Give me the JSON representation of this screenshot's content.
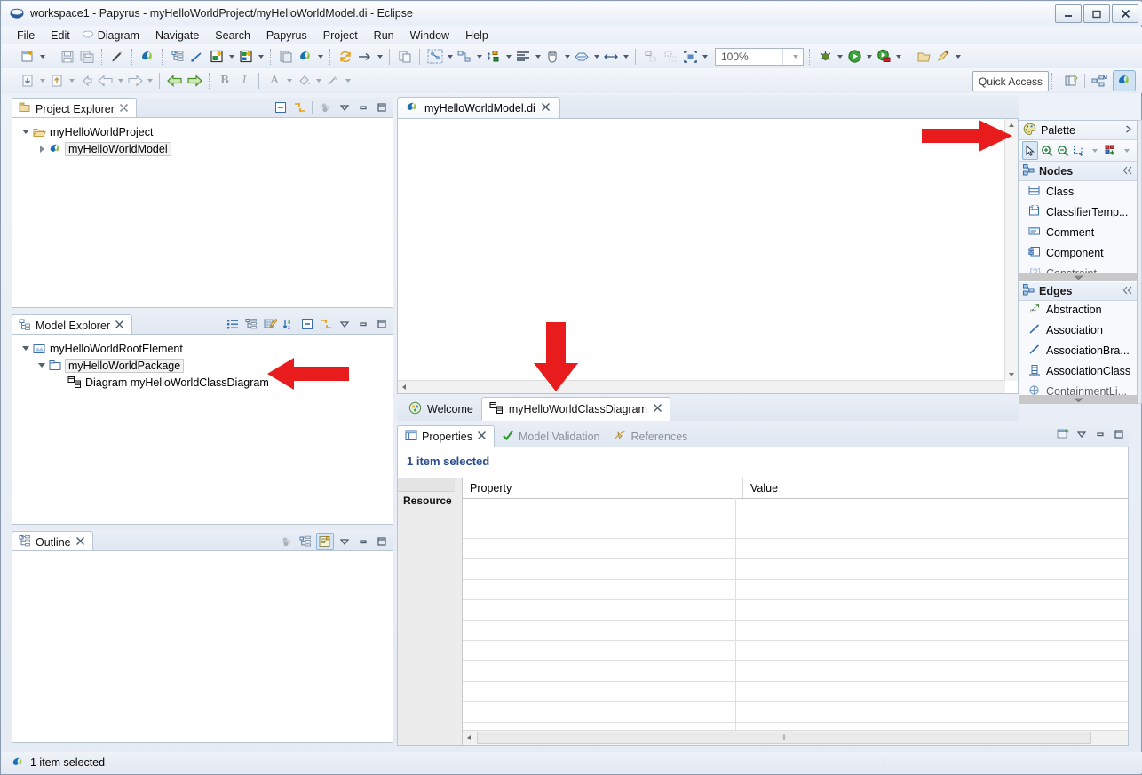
{
  "window": {
    "title": "workspace1 - Papyrus - myHelloWorldProject/myHelloWorldModel.di - Eclipse",
    "icon": "papyrus-icon",
    "minimize_label": "–",
    "maximize_label": "❐",
    "close_label": "✕"
  },
  "menubar": [
    {
      "label": "File",
      "icon": null
    },
    {
      "label": "Edit",
      "icon": null
    },
    {
      "label": "Diagram",
      "icon": "papyrus-icon"
    },
    {
      "label": "Navigate",
      "icon": null
    },
    {
      "label": "Search",
      "icon": null
    },
    {
      "label": "Papyrus",
      "icon": null
    },
    {
      "label": "Project",
      "icon": null
    },
    {
      "label": "Run",
      "icon": null
    },
    {
      "label": "Window",
      "icon": null
    },
    {
      "label": "Help",
      "icon": null
    }
  ],
  "toolbar_row1": {
    "zoom_value": "100%",
    "zoom_dropdown_icon": "chevron-down-icon",
    "items": [
      {
        "name": "new-wizard-button",
        "icon": "new-file-icon",
        "dropdown": true
      },
      {
        "sep": "dotted"
      },
      {
        "name": "save-button",
        "icon": "save-icon",
        "dropdown": false
      },
      {
        "name": "save-all-button",
        "icon": "save-all-icon",
        "dropdown": false
      },
      {
        "sep": "dotted"
      },
      {
        "name": "edit-pencil-button",
        "icon": "pencil-icon",
        "dropdown": false
      },
      {
        "sep": "dotted"
      },
      {
        "name": "papyrus-perspective-button",
        "icon": "papyrus-icon",
        "dropdown": false
      },
      {
        "sep": "dotted"
      },
      {
        "name": "outline-tree-button",
        "icon": "tree-outline-icon",
        "dropdown": false
      },
      {
        "name": "link-line-button",
        "icon": "diagonal-line-icon",
        "dropdown": false
      },
      {
        "name": "new-diagram-button",
        "icon": "new-diagram-icon",
        "dropdown": true
      },
      {
        "name": "new-model-button",
        "icon": "new-model-icon",
        "dropdown": true
      },
      {
        "sep": "dotted"
      },
      {
        "name": "copy-appearance-button",
        "icon": "copy-appearance-icon",
        "dropdown": false
      },
      {
        "name": "papyrus-menu-button",
        "icon": "papyrus-icon",
        "dropdown": true
      },
      {
        "sep": "dotted"
      },
      {
        "name": "refresh-button",
        "icon": "refresh-icon",
        "dropdown": false
      },
      {
        "name": "arrow-tool-button",
        "icon": "right-arrow-icon",
        "dropdown": true
      },
      {
        "sep": "solid"
      },
      {
        "name": "paste-style-button",
        "icon": "paste-style-icon",
        "dropdown": false
      },
      {
        "sep": "solid"
      },
      {
        "name": "select-all-button",
        "icon": "select-nodes-icon",
        "dropdown": true
      },
      {
        "name": "arrange-all-button",
        "icon": "arrange-icon",
        "dropdown": true
      },
      {
        "name": "distribute-button",
        "icon": "distribute-icon",
        "dropdown": true
      },
      {
        "name": "align-button",
        "icon": "align-left-icon",
        "dropdown": true
      },
      {
        "name": "hand-tool-button",
        "icon": "hand-icon",
        "dropdown": true
      },
      {
        "name": "routing-button",
        "icon": "routing-icon",
        "dropdown": true
      },
      {
        "name": "resize-button",
        "icon": "horizontal-resize-icon",
        "dropdown": true
      },
      {
        "sep": "solid"
      },
      {
        "name": "snap-button",
        "icon": "snap-icon",
        "dropdown": false
      },
      {
        "name": "grid-button",
        "icon": "grid-icon",
        "dropdown": false
      },
      {
        "name": "zoom-fit-button",
        "icon": "zoom-fit-icon",
        "dropdown": true
      }
    ],
    "trailing": [
      {
        "name": "debug-button",
        "icon": "debug-bug-icon",
        "dropdown": true
      },
      {
        "name": "run-button",
        "icon": "run-play-icon",
        "dropdown": true
      },
      {
        "name": "coverage-button",
        "icon": "coverage-icon",
        "dropdown": true
      },
      {
        "sep": "dotted"
      },
      {
        "name": "open-type-button",
        "icon": "open-folder-icon",
        "dropdown": false
      },
      {
        "name": "external-tools-button",
        "icon": "external-tools-icon",
        "dropdown": true
      }
    ]
  },
  "toolbar_row2": {
    "quick_access_label": "Quick Access",
    "items": [
      {
        "name": "import-button",
        "icon": "import-icon",
        "dropdown": true
      },
      {
        "name": "export-button",
        "icon": "export-icon",
        "dropdown": true
      },
      {
        "name": "back-history-button",
        "icon": "back-small-icon",
        "dropdown": false
      },
      {
        "name": "previous-annotation-button",
        "icon": "left-arrow-outline-icon",
        "dropdown": true
      },
      {
        "name": "next-annotation-button",
        "icon": "right-arrow-outline-icon",
        "dropdown": true
      },
      {
        "sep": "solid"
      },
      {
        "name": "back-button",
        "icon": "green-left-arrow-icon",
        "dropdown": false
      },
      {
        "name": "forward-button",
        "icon": "green-right-arrow-icon",
        "dropdown": false
      },
      {
        "sep": "dotted"
      },
      {
        "name": "bold-button",
        "icon": "bold-icon",
        "dropdown": false,
        "label": "B"
      },
      {
        "name": "italic-button",
        "icon": "italic-icon",
        "dropdown": false,
        "label": "I"
      },
      {
        "sep": "solid"
      },
      {
        "name": "font-color-button",
        "icon": "font-color-icon",
        "dropdown": true,
        "label": "A"
      },
      {
        "name": "fill-color-button",
        "icon": "fill-color-icon",
        "dropdown": true
      },
      {
        "name": "line-color-button",
        "icon": "line-color-icon",
        "dropdown": true
      }
    ],
    "perspective": [
      {
        "name": "open-perspective-button",
        "icon": "open-perspective-icon"
      },
      {
        "name": "modeling-perspective-button",
        "icon": "modeling-perspective-icon"
      },
      {
        "name": "papyrus-perspective-active-button",
        "icon": "papyrus-icon"
      }
    ]
  },
  "project_explorer": {
    "tab_label": "Project Explorer",
    "tab_icon": "project-explorer-icon",
    "close_icon": "close-icon",
    "tools": [
      {
        "name": "collapse-all-button",
        "icon": "collapse-all-icon"
      },
      {
        "name": "link-with-editor-button",
        "icon": "link-editor-icon"
      },
      {
        "name": "view-menu-filter-button",
        "icon": "filter-icon"
      },
      {
        "name": "view-menu-button",
        "icon": "chevron-down-icon"
      },
      {
        "name": "minimize-button",
        "icon": "minimize-icon"
      },
      {
        "name": "maximize-button",
        "icon": "maximize-icon"
      }
    ],
    "tree": [
      {
        "label": "myHelloWorldProject",
        "icon": "open-folder-icon",
        "twisty": "open",
        "depth": 0,
        "selected": false
      },
      {
        "label": "myHelloWorldModel",
        "icon": "papyrus-icon",
        "twisty": "closed",
        "depth": 1,
        "selected": true
      }
    ]
  },
  "model_explorer": {
    "tab_label": "Model Explorer",
    "tab_icon": "model-explorer-icon",
    "close_icon": "close-icon",
    "tools": [
      {
        "name": "show-properties-button",
        "icon": "list-icon"
      },
      {
        "name": "show-types-button",
        "icon": "types-tree-icon"
      },
      {
        "name": "edit-filters-button",
        "icon": "edit-filter-icon"
      },
      {
        "name": "sort-az-button",
        "icon": "sort-az-icon"
      },
      {
        "name": "collapse-all-button",
        "icon": "collapse-all-icon"
      },
      {
        "name": "link-with-editor-button",
        "icon": "link-editor-icon"
      },
      {
        "name": "view-menu-button",
        "icon": "chevron-down-icon"
      },
      {
        "name": "minimize-button",
        "icon": "minimize-icon"
      },
      {
        "name": "maximize-button",
        "icon": "maximize-icon"
      }
    ],
    "tree": [
      {
        "label": "myHelloWorldRootElement",
        "icon": "model-root-icon",
        "twisty": "open",
        "depth": 0,
        "selected": false
      },
      {
        "label": "myHelloWorldPackage",
        "icon": "package-icon",
        "twisty": "open",
        "depth": 1,
        "selected": true
      },
      {
        "label": "Diagram myHelloWorldClassDiagram",
        "icon": "class-diagram-icon",
        "twisty": "none",
        "depth": 2,
        "selected": false
      }
    ]
  },
  "outline": {
    "tab_label": "Outline",
    "tab_icon": "outline-icon",
    "close_icon": "close-icon",
    "tools": [
      {
        "name": "filter-button",
        "icon": "filter-icon"
      },
      {
        "name": "hierarchy-button",
        "icon": "hierarchy-icon"
      },
      {
        "name": "overview-button",
        "icon": "overview-icon",
        "toggled": true
      },
      {
        "name": "view-menu-button",
        "icon": "chevron-down-icon"
      },
      {
        "name": "minimize-button",
        "icon": "minimize-icon"
      },
      {
        "name": "maximize-button",
        "icon": "maximize-icon"
      }
    ]
  },
  "editor": {
    "tab_label": "myHelloWorldModel.di",
    "tab_icon": "papyrus-icon",
    "close_icon": "close-icon",
    "bottom_tabs": [
      {
        "label": "Welcome",
        "icon": "welcome-icon",
        "active": false,
        "closable": false
      },
      {
        "label": "myHelloWorldClassDiagram",
        "icon": "class-diagram-icon",
        "active": true,
        "closable": true
      }
    ]
  },
  "palette": {
    "title": "Palette",
    "title_icon": "palette-icon",
    "expand_icon": "chevron-right-icon",
    "tools": [
      {
        "name": "select-tool",
        "icon": "arrow-select-icon",
        "selected": true,
        "dropdown": false
      },
      {
        "name": "zoom-in-tool",
        "icon": "zoom-in-icon",
        "selected": false,
        "dropdown": false
      },
      {
        "name": "zoom-out-tool",
        "icon": "zoom-out-icon",
        "selected": false,
        "dropdown": false
      },
      {
        "name": "marquee-tool",
        "icon": "marquee-icon",
        "selected": false,
        "dropdown": true
      },
      {
        "name": "create-node-tool",
        "icon": "create-node-icon",
        "selected": false,
        "dropdown": true
      }
    ],
    "drawers": [
      {
        "label": "Nodes",
        "icon": "nodes-drawer-icon",
        "collapse_icon": "collapse-drawer-icon",
        "items": [
          {
            "label": "Class",
            "icon": "class-icon"
          },
          {
            "label": "ClassifierTemp...",
            "icon": "classifier-template-icon"
          },
          {
            "label": "Comment",
            "icon": "comment-icon"
          },
          {
            "label": "Component",
            "icon": "component-icon"
          },
          {
            "label": "Constraint",
            "icon": "constraint-icon"
          }
        ]
      },
      {
        "label": "Edges",
        "icon": "edges-drawer-icon",
        "collapse_icon": "collapse-drawer-icon",
        "items": [
          {
            "label": "Abstraction",
            "icon": "abstraction-icon"
          },
          {
            "label": "Association",
            "icon": "association-icon"
          },
          {
            "label": "AssociationBra...",
            "icon": "association-branch-icon"
          },
          {
            "label": "AssociationClass",
            "icon": "association-class-icon"
          },
          {
            "label": "ContainmentLi...",
            "icon": "containment-link-icon"
          }
        ]
      }
    ]
  },
  "properties": {
    "tabs": [
      {
        "label": "Properties",
        "icon": "properties-icon",
        "active": true,
        "closable": true
      },
      {
        "label": "Model Validation",
        "icon": "validation-check-icon",
        "active": false,
        "closable": false
      },
      {
        "label": "References",
        "icon": "references-icon",
        "active": false,
        "closable": false
      }
    ],
    "tools": [
      {
        "name": "pin-properties-button",
        "icon": "pin-view-icon"
      },
      {
        "name": "view-menu-button",
        "icon": "chevron-down-icon"
      },
      {
        "name": "minimize-button",
        "icon": "minimize-icon"
      },
      {
        "name": "maximize-button",
        "icon": "maximize-icon"
      }
    ],
    "heading": "1 item selected",
    "side_tab": "Resource",
    "columns": [
      "Property",
      "Value"
    ],
    "rows": [
      {
        "property": "",
        "value": ""
      },
      {
        "property": "",
        "value": ""
      },
      {
        "property": "",
        "value": ""
      },
      {
        "property": "",
        "value": ""
      },
      {
        "property": "",
        "value": ""
      },
      {
        "property": "",
        "value": ""
      },
      {
        "property": "",
        "value": ""
      },
      {
        "property": "",
        "value": ""
      },
      {
        "property": "",
        "value": ""
      },
      {
        "property": "",
        "value": ""
      },
      {
        "property": "",
        "value": ""
      },
      {
        "property": "",
        "value": ""
      }
    ],
    "scroll_grip": "‖"
  },
  "statusbar": {
    "icon": "papyrus-icon",
    "text": "1 item selected",
    "grip": "⋮"
  },
  "annotations": [
    {
      "name": "annotation-arrow-palette",
      "direction": "right",
      "color": "#e81c1c"
    },
    {
      "name": "annotation-arrow-diagram-tab",
      "direction": "down",
      "color": "#e81c1c"
    },
    {
      "name": "annotation-arrow-class-diagram",
      "direction": "left",
      "color": "#e81c1c"
    }
  ],
  "colors": {
    "accent": "#2a4d8f",
    "annotation_red": "#e81c1c",
    "papyrus_green": "#8cc63f",
    "papyrus_blue": "#1a6fb5"
  }
}
